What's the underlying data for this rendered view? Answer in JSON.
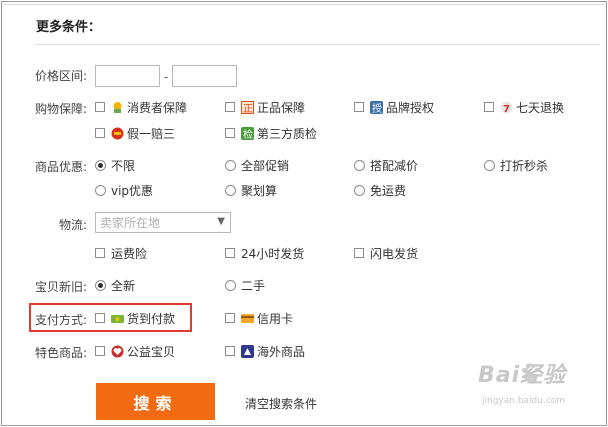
{
  "title": "更多条件：",
  "price": {
    "label": "价格区间:",
    "separator": "-"
  },
  "guarantee": {
    "label": "购物保障:",
    "options": [
      "消费者保障",
      "正品保障",
      "品牌授权",
      "七天退换",
      "假一赔三",
      "第三方质检"
    ]
  },
  "discount": {
    "label": "商品优惠:",
    "options": [
      "不限",
      "全部促销",
      "搭配减价",
      "打折秒杀",
      "vip优惠",
      "聚划算",
      "免运费"
    ],
    "selected": "不限"
  },
  "logistics": {
    "label": "物流:",
    "placeholder": "卖家所在地",
    "options": [
      "运费险",
      "24小时发货",
      "闪电发货"
    ]
  },
  "condition": {
    "label": "宝贝新旧:",
    "options": [
      "全新",
      "二手"
    ],
    "selected": "全新"
  },
  "payment": {
    "label": "支付方式:",
    "options": [
      "货到付款",
      "信用卡"
    ]
  },
  "special": {
    "label": "特色商品:",
    "options": [
      "公益宝贝",
      "海外商品"
    ]
  },
  "actions": {
    "search": "搜索",
    "clear": "清空搜索条件"
  },
  "watermark": {
    "brand": "Bai经验",
    "sub": "jingyan.baidu.com"
  },
  "colors": {
    "accent": "#f26b10",
    "highlight": "#e03c31"
  },
  "icons": {
    "consumer": "consumer-protection-icon",
    "genuine": "genuine-icon",
    "brand": "brand-auth-icon",
    "seven": "seven-day-return-icon",
    "fake": "fake-compensation-icon",
    "qc": "third-party-qc-icon",
    "cod": "cash-on-delivery-icon",
    "card": "credit-card-icon",
    "charity": "charity-icon",
    "overseas": "overseas-icon"
  }
}
